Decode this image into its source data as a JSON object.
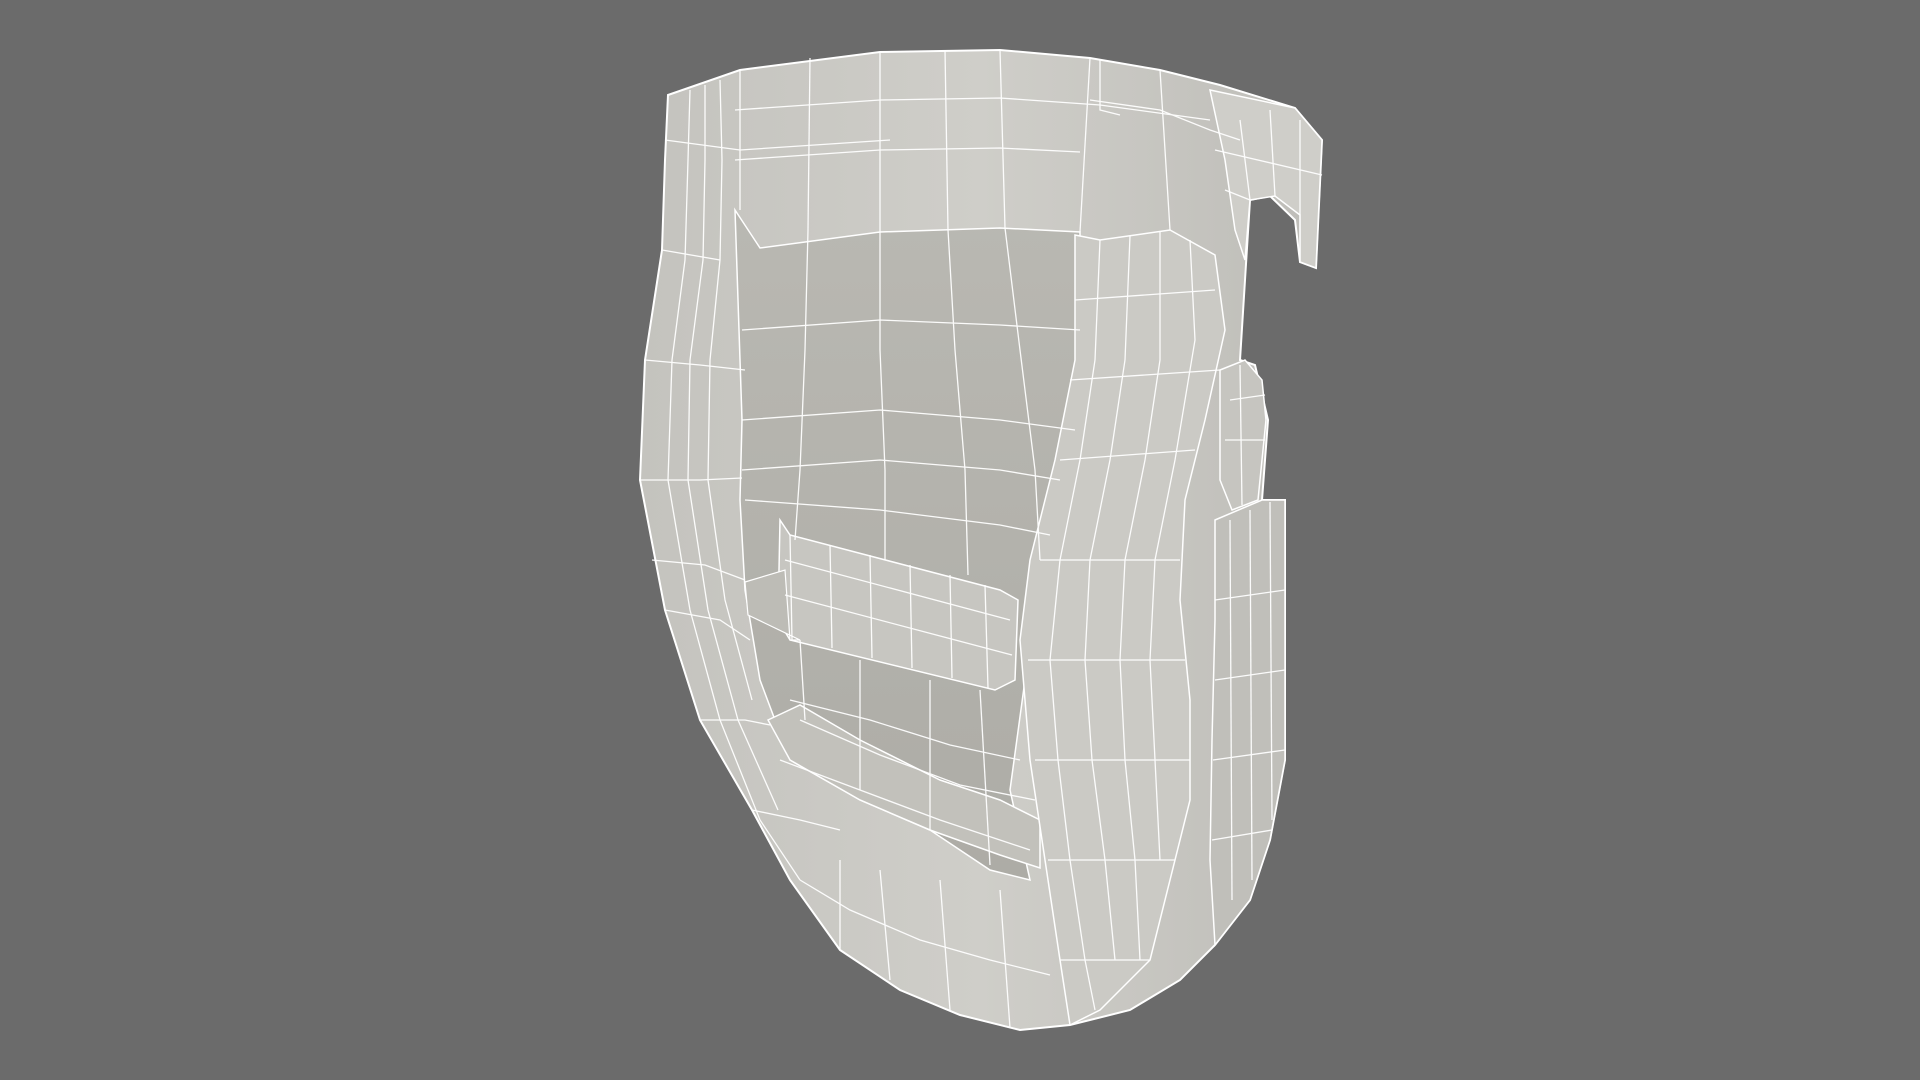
{
  "scene": {
    "background_color": "#6b6b6b",
    "model": {
      "render_style": "wireframe-on-shaded",
      "surface_color": "#c9c8c3",
      "shadow_color": "#a9a8a2",
      "highlight_color": "#dcdbd6",
      "wire_color": "#ffffff"
    }
  }
}
